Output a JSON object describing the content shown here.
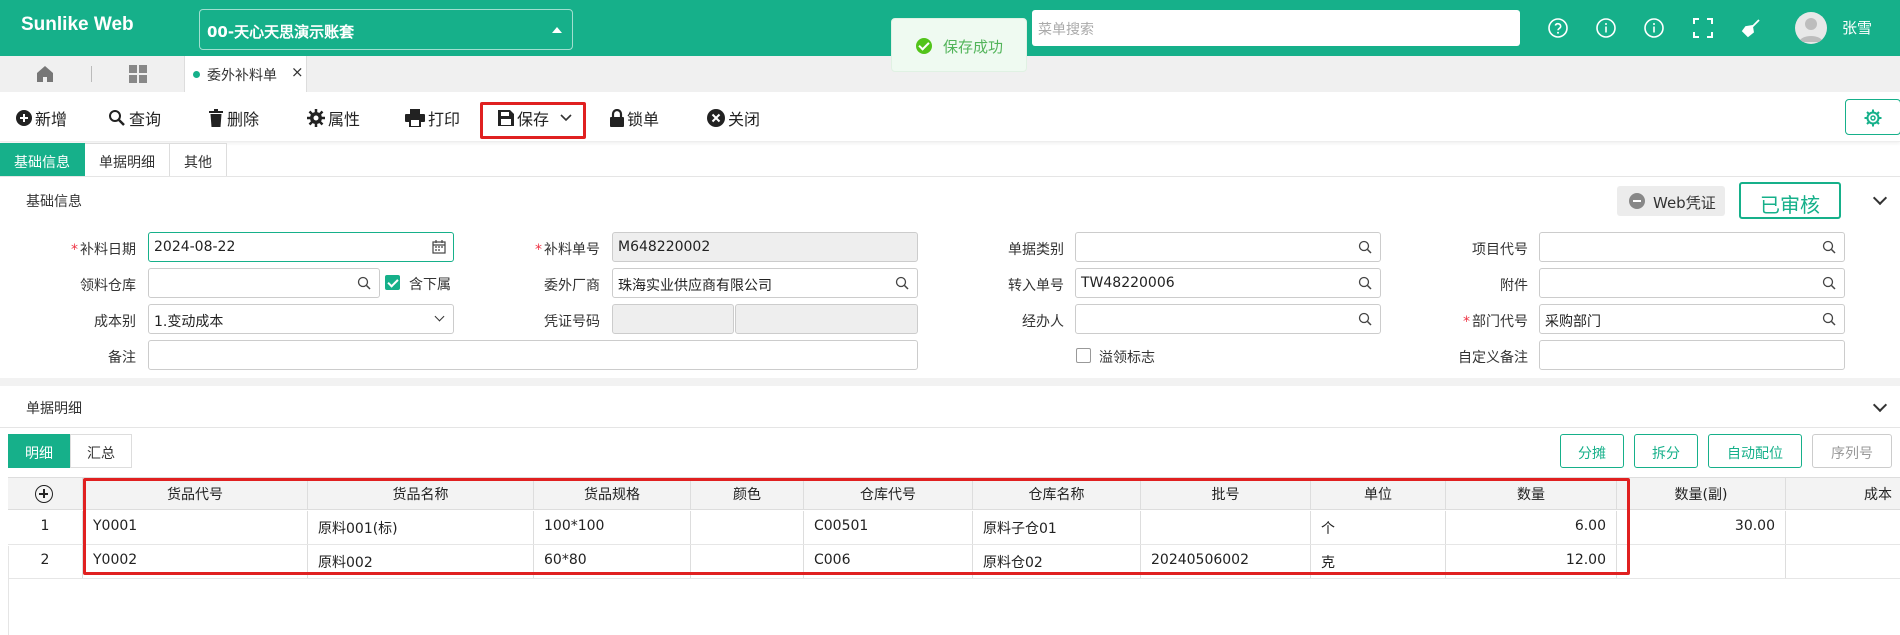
{
  "app": {
    "brand": "Sunlike Web",
    "account": "00-天心天思演示账套",
    "search_placeholder": "菜单搜索",
    "username": "张雪",
    "accent": "#16b08a"
  },
  "toast": {
    "message": "保存成功"
  },
  "tabs": {
    "doc_tab_label": "委外补料单"
  },
  "toolbar": {
    "new": "新增",
    "query": "查询",
    "delete": "删除",
    "properties": "属性",
    "print": "打印",
    "save": "保存",
    "lock": "锁单",
    "close": "关闭"
  },
  "form_tabs": [
    "基础信息",
    "单据明细",
    "其他"
  ],
  "basic_section": {
    "title": "基础信息",
    "web_voucher": "Web凭证",
    "status": "已审核"
  },
  "form": {
    "supply_date_label": "补料日期",
    "supply_date": "2024-08-22",
    "supply_no_label": "补料单号",
    "supply_no": "M648220002",
    "doc_type_label": "单据类别",
    "doc_type": "",
    "project_code_label": "项目代号",
    "project_code": "",
    "warehouse_label": "领料仓库",
    "warehouse": "",
    "include_sub_label": "含下属",
    "vendor_label": "委外厂商",
    "vendor": "珠海实业供应商有限公司",
    "transfer_no_label": "转入单号",
    "transfer_no": "TW48220006",
    "attachment_label": "附件",
    "attachment": "",
    "cost_type_label": "成本别",
    "cost_type": "1.变动成本",
    "voucher_no_label": "凭证号码",
    "handler_label": "经办人",
    "handler": "",
    "dept_code_label": "部门代号",
    "dept_code": "采购部门",
    "remark_label": "备注",
    "remark": "",
    "overflow_label": "溢领标志",
    "custom_remark_label": "自定义备注",
    "custom_remark": ""
  },
  "detail_section": {
    "title": "单据明细",
    "tabs": [
      "明细",
      "汇总"
    ],
    "buttons": {
      "allocate": "分摊",
      "split": "拆分",
      "auto_match": "自动配位",
      "serial": "序列号"
    }
  },
  "table": {
    "headers": [
      "货品代号",
      "货品名称",
      "货品规格",
      "颜色",
      "仓库代号",
      "仓库名称",
      "批号",
      "单位",
      "数量",
      "数量(副)",
      "成本"
    ],
    "rows": [
      {
        "no": "1",
        "code": "Y0001",
        "name": "原料001(标)",
        "spec": "100*100",
        "color": "",
        "wh_code": "C00501",
        "wh_name": "原料子仓01",
        "batch": "",
        "unit": "个",
        "qty": "6.00",
        "qty2": "30.00",
        "cost": ""
      },
      {
        "no": "2",
        "code": "Y0002",
        "name": "原料002",
        "spec": "60*80",
        "color": "",
        "wh_code": "C006",
        "wh_name": "原料仓02",
        "batch": "20240506002",
        "unit": "克",
        "qty": "12.00",
        "qty2": "",
        "cost": ""
      }
    ]
  }
}
